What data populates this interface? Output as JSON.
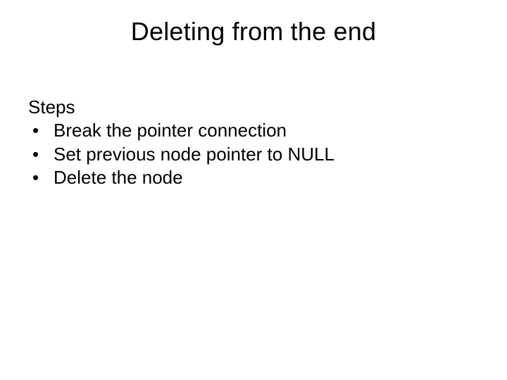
{
  "title": "Deleting from the end",
  "steps_label": "Steps",
  "bullets": {
    "0": "Break the pointer connection",
    "1": "Set previous node pointer to NULL",
    "2": "Delete the node"
  }
}
